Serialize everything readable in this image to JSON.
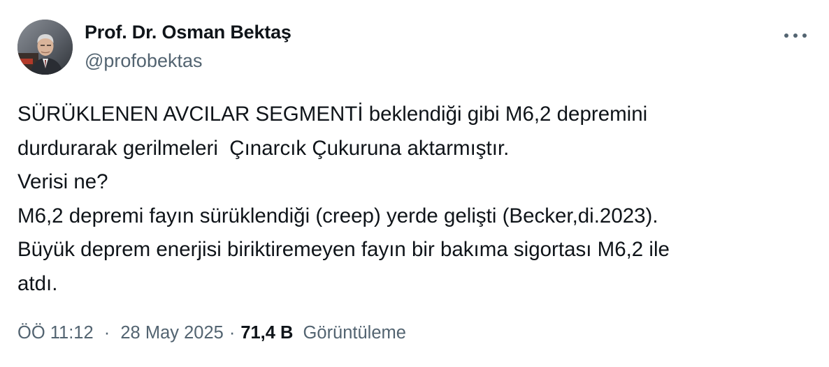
{
  "author": {
    "name": "Prof. Dr. Osman Bektaş",
    "handle": "@profobektas"
  },
  "tweet": {
    "lines": [
      "SÜRÜKLENEN AVCILAR SEGMENTİ beklendiği gibi M6,2 depremini",
      "durdurarak gerilmeleri  Çınarcık Çukuruna aktarmıştır.",
      "Verisi ne?",
      "M6,2 depremi fayın sürüklendiği (creep) yerde gelişti (Becker,di.2023).",
      "Büyük deprem enerjisi biriktiremeyen fayın bir bakıma sigortası M6,2 ile",
      "atdı."
    ]
  },
  "meta": {
    "time": "ÖÖ 11:12",
    "separator": "·",
    "date": "28 May 2025",
    "views_count": "71,4 B",
    "views_label": "Görüntüleme"
  },
  "icons": {
    "more": "more-horizontal-icon",
    "avatar": "profile-photo"
  },
  "colors": {
    "text_primary": "#0f1419",
    "text_secondary": "#536471",
    "background": "#ffffff"
  }
}
